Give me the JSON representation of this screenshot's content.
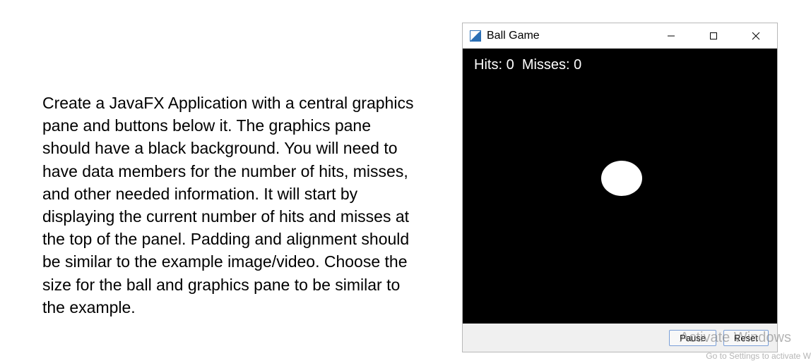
{
  "description": "Create a JavaFX Application with a central graphics pane and buttons below it. The graphics pane should have a black background. You will need to have data members for the number of hits, misses, and other needed information.  It will start by displaying the current number of hits and misses at the top of the panel.  Padding and alignment should be similar to the example image/video.  Choose the size for the ball and graphics pane to be similar to the example.",
  "window": {
    "title": "Ball Game",
    "score": {
      "hits_label": "Hits:",
      "hits_value": "0",
      "misses_label": "Misses:",
      "misses_value": "0"
    },
    "buttons": {
      "pause": "Pause",
      "reset": "Reset"
    }
  },
  "watermark": {
    "line1": "Activate Windows",
    "line2": "Go to Settings to activate W"
  }
}
